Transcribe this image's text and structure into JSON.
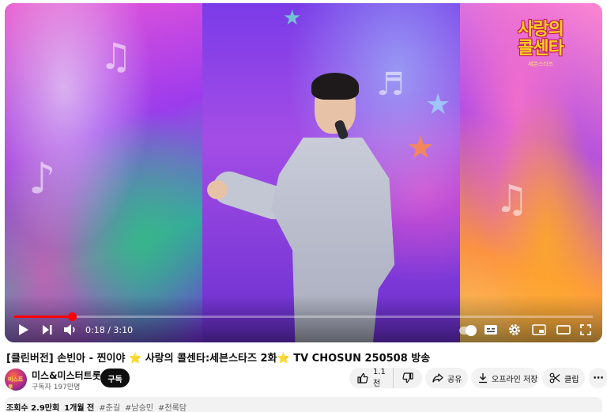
{
  "player": {
    "time_current": "0:18",
    "time_separator": " / ",
    "time_total": "3:10",
    "progress_fraction": 0.1,
    "accent_color": "#ff0000",
    "show_logo": {
      "line1": "사랑의",
      "line2": "콜센타",
      "subtitle": "세븐스타즈"
    },
    "controls": {
      "left": [
        "play-icon",
        "next-icon",
        "volume-icon"
      ],
      "right": [
        "autoplay-toggle",
        "subtitles-icon",
        "settings-icon",
        "miniplayer-icon",
        "theater-icon",
        "fullscreen-icon"
      ]
    }
  },
  "video": {
    "title": "[클린버전] 손빈아 - 찐이야 ⭐ 사랑의 콜센타:세븐스타즈 2화⭐ TV CHOSUN 250508 방송"
  },
  "channel": {
    "name": "미스&미스터트롯",
    "subscribers": "구독자 197만명",
    "avatar_text": "미스트롯"
  },
  "actions": {
    "subscribe": "구독",
    "likes": "1.1천",
    "share": "공유",
    "download": "오프라인 저장",
    "clip": "클립",
    "more": "⋯"
  },
  "description": {
    "views": "조회수 2.9만회",
    "age": "1개월 전",
    "hashtags": [
      "#춘길",
      "#남승민",
      "#천록담"
    ]
  }
}
